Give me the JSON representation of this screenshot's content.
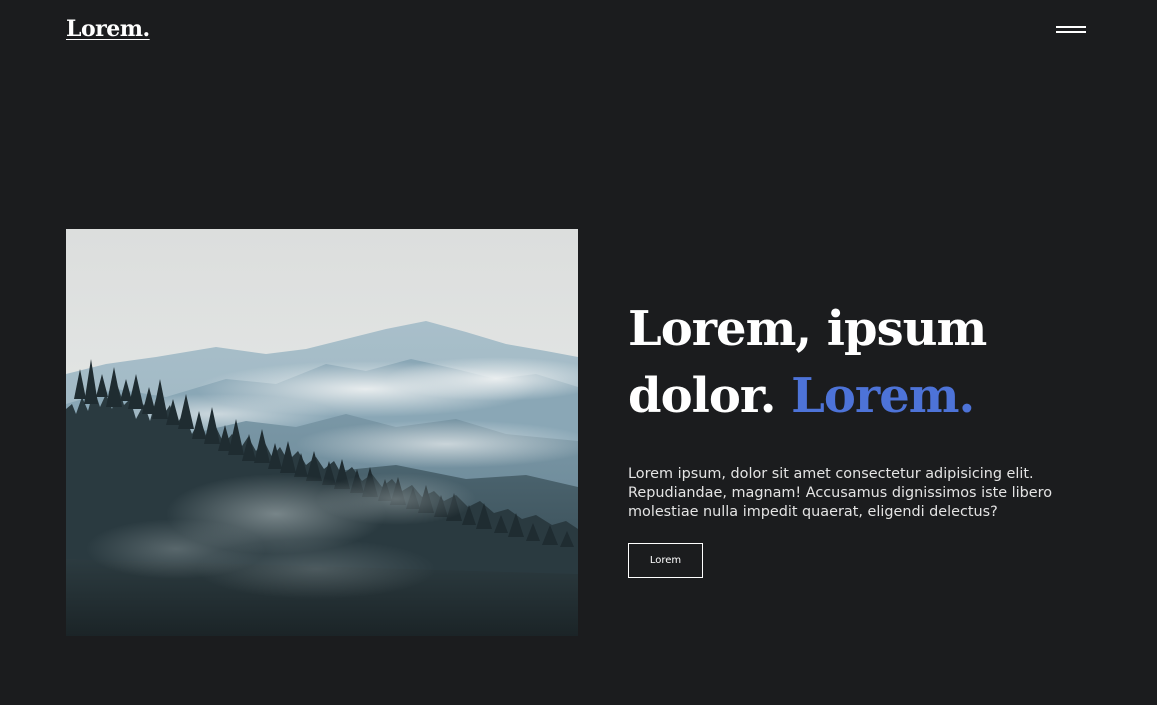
{
  "header": {
    "logo": "Lorem.",
    "menu_icon": "hamburger-menu-icon"
  },
  "hero": {
    "image_alt": "misty-forest-mountains-photo",
    "headline_main": "Lorem, ipsum dolor.",
    "headline_accent": "Lorem.",
    "body": "Lorem ipsum, dolor sit amet consectetur adipisicing elit. Repudiandae, magnam! Accusamus dignissimos iste libero molestiae nulla impedit quaerat, eligendi delectus?",
    "button_label": "Lorem"
  },
  "colors": {
    "background": "#1b1c1e",
    "text": "#ffffff",
    "accent": "#4d73d8"
  }
}
